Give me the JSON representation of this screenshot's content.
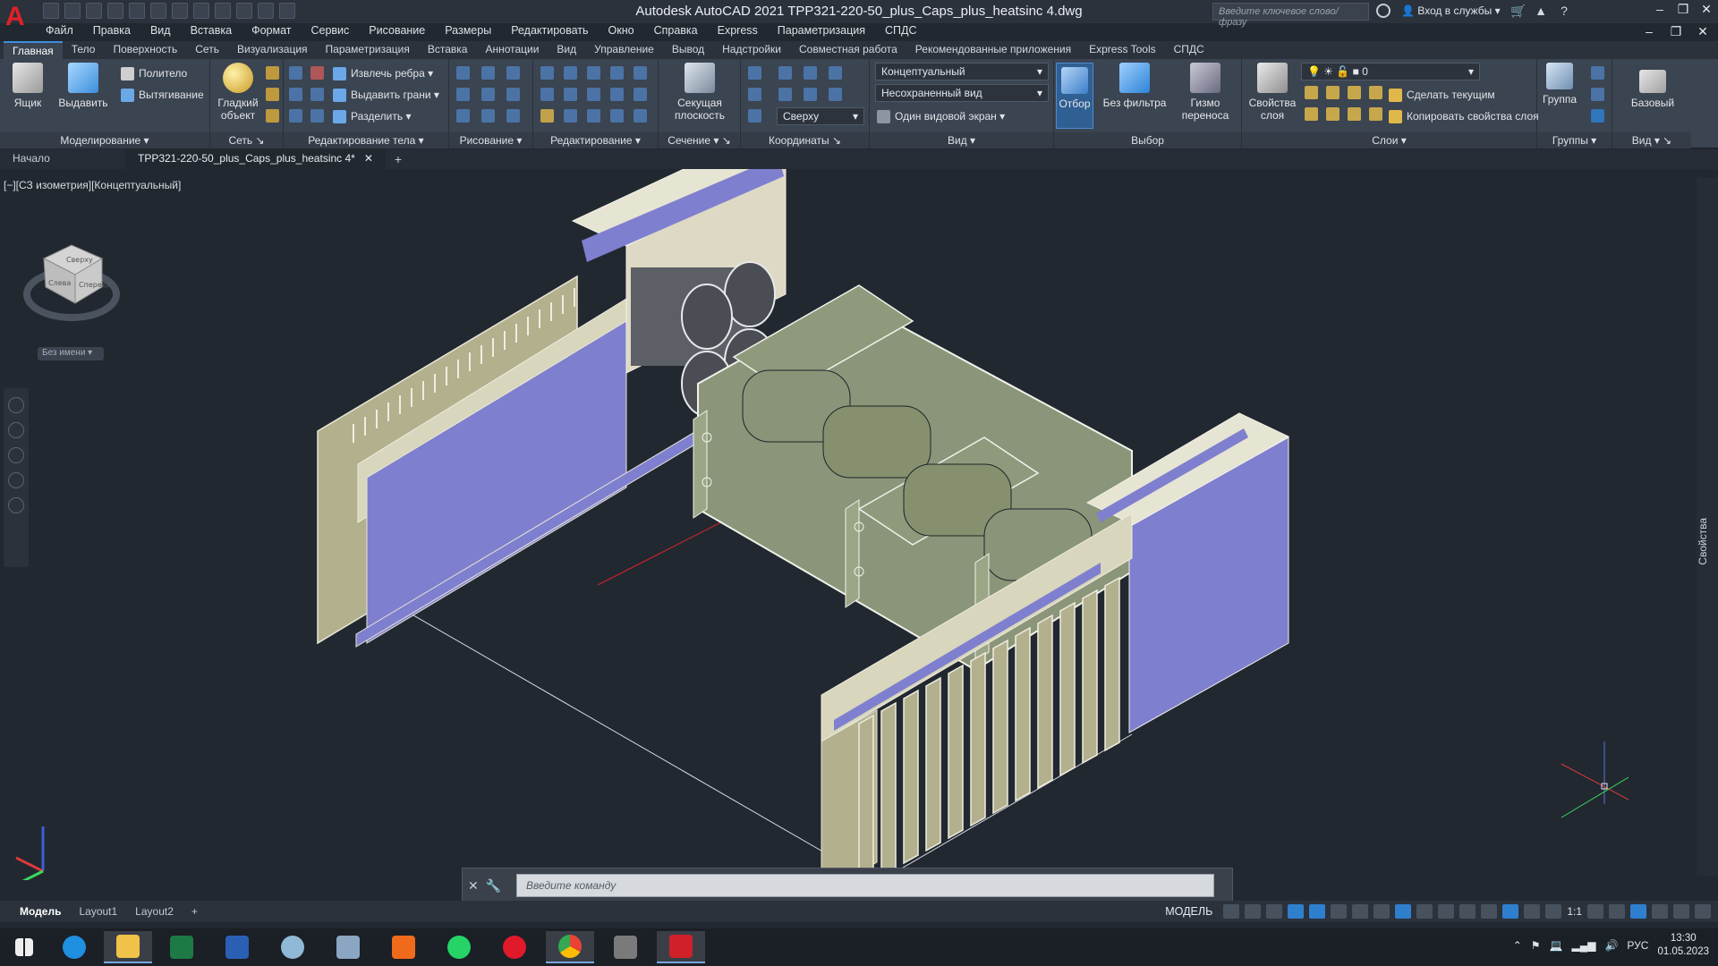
{
  "app": {
    "logo_letter": "A",
    "window_title": "Autodesk AutoCAD 2021   TPP321-220-50_plus_Caps_plus_heatsinc 4.dwg",
    "search_placeholder": "Введите ключевое слово/фразу",
    "signin_label": "Вход в службы"
  },
  "menu": [
    "Файл",
    "Правка",
    "Вид",
    "Вставка",
    "Формат",
    "Сервис",
    "Рисование",
    "Размеры",
    "Редактировать",
    "Окно",
    "Справка",
    "Express",
    "Параметризация",
    "СПДС"
  ],
  "ribbon_tabs": [
    "Главная",
    "Тело",
    "Поверхность",
    "Сеть",
    "Визуализация",
    "Параметризация",
    "Вставка",
    "Аннотации",
    "Вид",
    "Управление",
    "Вывод",
    "Надстройки",
    "Совместная работа",
    "Рекомендованные приложения",
    "Express Tools",
    "СПДС"
  ],
  "ribbon": {
    "modeling": {
      "title": "Моделирование",
      "box": "Ящик",
      "extrude": "Выдавить",
      "polysolid": "Политело",
      "presspull": "Вытягивание"
    },
    "mesh": {
      "title": "Сеть",
      "smooth": "Гладкий объект"
    },
    "solid_edit": {
      "title": "Редактирование тела",
      "extract_edges": "Извлечь ребра",
      "extrude_faces": "Выдавить грани",
      "separate": "Разделить"
    },
    "draw": {
      "title": "Рисование"
    },
    "modify": {
      "title": "Редактирование"
    },
    "section": {
      "title": "Сечение",
      "section_plane": "Секущая плоскость"
    },
    "coordinates": {
      "title": "Координаты",
      "view_dd": "Сверху"
    },
    "view": {
      "title": "Вид",
      "visual_style": "Концептуальный",
      "named_view": "Несохраненный вид",
      "single_viewport": "Один видовой экран"
    },
    "selection": {
      "title": "Выбор",
      "culling": "Отбор",
      "no_filter": "Без фильтра",
      "gizmo": "Гизмо переноса"
    },
    "layers": {
      "title": "Слои",
      "layer_props": "Свойства слоя",
      "current_layer": "0",
      "make_current": "Сделать текущим",
      "match_layer": "Копировать свойства слоя"
    },
    "groups": {
      "title": "Группы",
      "group": "Группа"
    },
    "view2": {
      "title": "Вид",
      "base": "Базовый"
    }
  },
  "file_tabs": {
    "start": "Начало",
    "drawing": "TPP321-220-50_plus_Caps_plus_heatsinc 4*"
  },
  "viewport": {
    "label": "[−][СЗ изометрия][Концептуальный]",
    "unnamed": "Без имени",
    "properties": "Свойства",
    "cube_faces": [
      "Сверху",
      "Слева",
      "Спереди"
    ]
  },
  "command": {
    "placeholder": "Введите команду"
  },
  "layout_tabs": [
    "Модель",
    "Layout1",
    "Layout2"
  ],
  "status": {
    "model": "МОДЕЛЬ",
    "scale": "1:1"
  },
  "tray": {
    "lang": "РУС",
    "time": "13:30",
    "date": "01.05.2023"
  },
  "colors": {
    "background": "#212830",
    "ribbon": "#3b4451",
    "accent": "#2f7fcf",
    "heatsink": "#b3b08e",
    "capacitor": "#8b9579",
    "panel_blue": "#7f7fcf"
  }
}
